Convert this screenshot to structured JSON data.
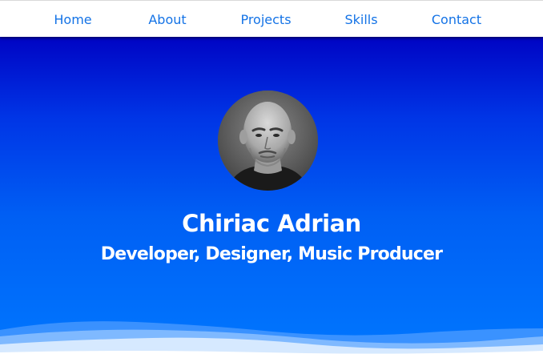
{
  "nav": {
    "home": "Home",
    "about": "About",
    "projects": "Projects",
    "skills": "Skills",
    "contact": "Contact"
  },
  "hero": {
    "name": "Chiriac Adrian",
    "subtitle": "Developer, Designer, Music Producer"
  },
  "colors": {
    "nav_link": "#1473e6",
    "hero_top": "#0004c4",
    "hero_bottom": "#0078ff",
    "hero_text": "#ffffff"
  }
}
